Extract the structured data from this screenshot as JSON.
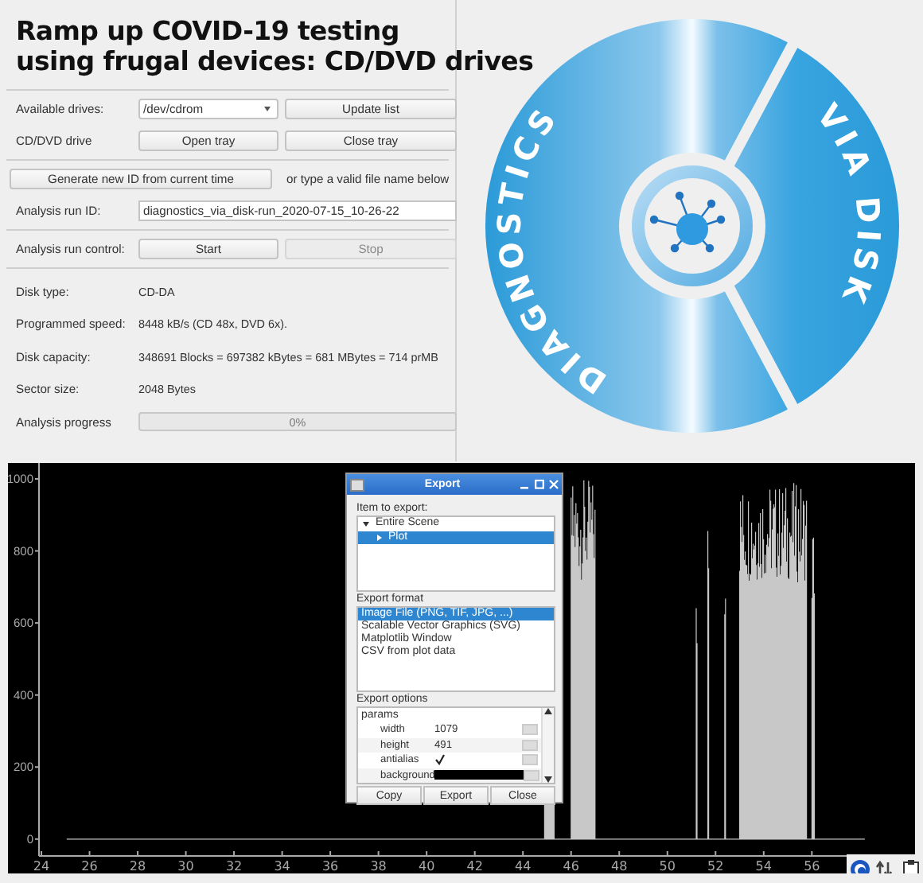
{
  "title_lines": [
    "Ramp up COVID-19 testing",
    "using frugal devices: CD/DVD drives"
  ],
  "drives": {
    "label": "Available drives:",
    "value": "/dev/cdrom",
    "button": "Update list"
  },
  "drive": {
    "label": "CD/DVD drive",
    "buttons": [
      {
        "label": "Open tray",
        "disabled": false
      },
      {
        "label": "Close tray",
        "disabled": false
      }
    ]
  },
  "id_generation": {
    "button": "Generate new ID from current time",
    "hint": "or type a valid file name below"
  },
  "run_id": {
    "label": "Analysis run ID:",
    "value": "diagnostics_via_disk-run_2020-07-15_10-26-22"
  },
  "run_control": {
    "label": "Analysis run control:",
    "buttons": [
      {
        "label": "Start",
        "disabled": false
      },
      {
        "label": "Stop",
        "disabled": true
      }
    ]
  },
  "info": [
    {
      "label": "Disk type:",
      "value": "CD-DA"
    },
    {
      "label": "Programmed speed:",
      "value": "8448 kB/s (CD  48x, DVD  6x)."
    },
    {
      "label": "Disk capacity:",
      "value": "348691 Blocks = 697382 kBytes = 681 MBytes = 714 prMB"
    },
    {
      "label": "Sector size:",
      "value": "2048 Bytes"
    }
  ],
  "progress": {
    "label": "Analysis progress",
    "level": 0,
    "reading": "0%"
  },
  "logo": {
    "text_left": "DIAGNOSTICS",
    "text_right": "VIA DISK"
  },
  "plot": {
    "y_ticks": [
      "1000",
      "800",
      "600",
      "400",
      "200",
      "0"
    ],
    "x_ticks": [
      "24",
      "26",
      "28",
      "30",
      "32",
      "34",
      "36",
      "38",
      "40",
      "42",
      "44",
      "46",
      "48",
      "50",
      "52",
      "54",
      "56"
    ]
  },
  "export_dialog": {
    "title": "Export",
    "items_label": "Item to export:",
    "tree": [
      {
        "label": "Entire Scene",
        "expanded": true,
        "selected": false,
        "children": [
          {
            "label": "Plot",
            "expanded": false,
            "selected": true
          }
        ]
      }
    ],
    "formats_label": "Export format",
    "formats": [
      {
        "label": "Image File (PNG, TIF, JPG, ...)",
        "selected": true
      },
      {
        "label": "Scalable Vector Graphics (SVG)",
        "selected": false
      },
      {
        "label": "Matplotlib Window",
        "selected": false
      },
      {
        "label": "CSV from plot data",
        "selected": false
      }
    ],
    "options_label": "Export options",
    "params_label": "params",
    "params": [
      {
        "kind": "number",
        "name": "width",
        "value": "1079"
      },
      {
        "kind": "number",
        "name": "height",
        "value": "491"
      },
      {
        "kind": "checkbox",
        "name": "antialias",
        "checked": true
      },
      {
        "kind": "color",
        "name": "background",
        "color": "#000000"
      }
    ],
    "buttons": [
      "Copy",
      "Export",
      "Close"
    ]
  }
}
